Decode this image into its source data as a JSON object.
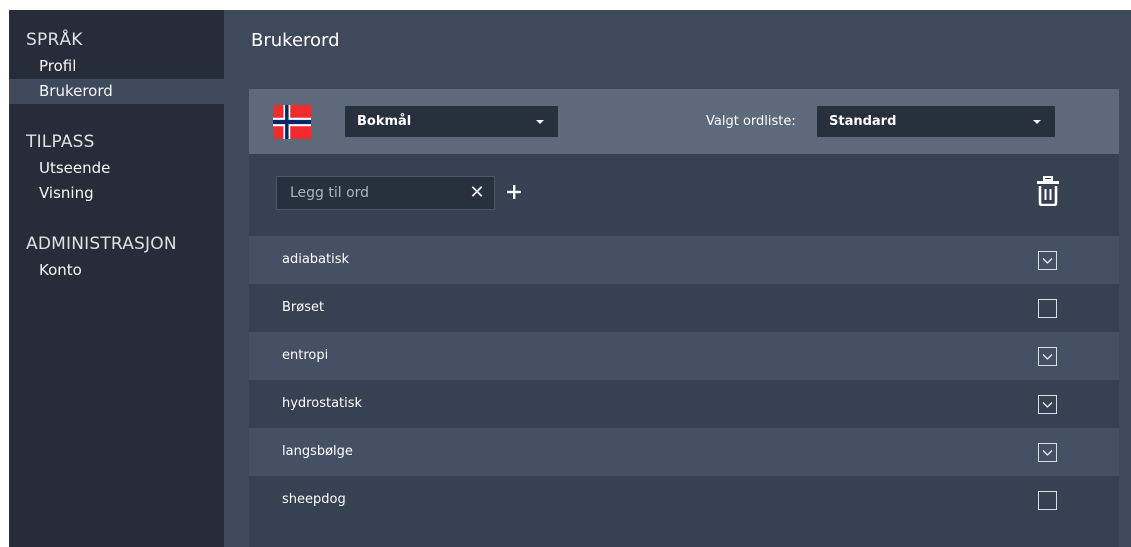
{
  "sidebar": {
    "sections": [
      {
        "heading": "SPRÅK",
        "items": [
          "Profil",
          "Brukerord"
        ]
      },
      {
        "heading": "TILPASS",
        "items": [
          "Utseende",
          "Visning"
        ]
      },
      {
        "heading": "ADMINISTRASJON",
        "items": [
          "Konto"
        ]
      }
    ],
    "active_item": "Brukerord"
  },
  "page": {
    "title": "Brukerord"
  },
  "toolbar": {
    "flag_icon": "norway-flag-icon",
    "language_value": "Bokmål",
    "wordlist_label": "Valgt ordliste:",
    "wordlist_value": "Standard"
  },
  "add_word": {
    "placeholder": "Legg til ord",
    "clear_icon": "close-icon",
    "add_icon": "plus-icon",
    "delete_icon": "trash-icon"
  },
  "words": [
    {
      "word": "adiabatisk",
      "checked": true
    },
    {
      "word": "Brøset",
      "checked": false
    },
    {
      "word": "entropi",
      "checked": true
    },
    {
      "word": "hydrostatisk",
      "checked": true
    },
    {
      "word": "langsbølge",
      "checked": true
    },
    {
      "word": "sheepdog",
      "checked": false
    }
  ],
  "colors": {
    "sidebar_bg": "#272d38",
    "main_bg": "#3e4a5c",
    "toolbar_bg": "#5d6a7c",
    "row_alt_bg": "#445064"
  }
}
